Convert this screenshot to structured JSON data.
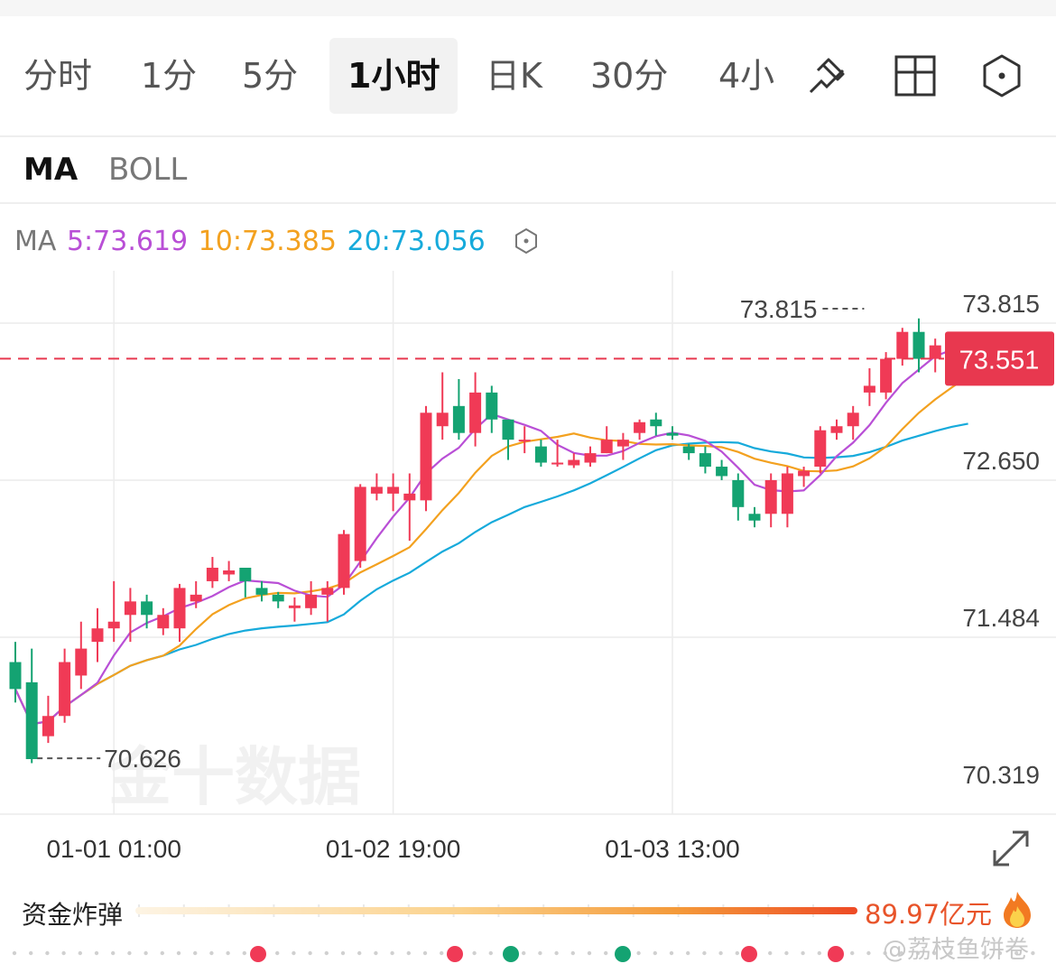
{
  "tabs": [
    {
      "label": "分时",
      "active": false
    },
    {
      "label": "1分",
      "active": false
    },
    {
      "label": "5分",
      "active": false
    },
    {
      "label": "1小时",
      "active": true
    },
    {
      "label": "日K",
      "active": false
    },
    {
      "label": "30分",
      "active": false
    },
    {
      "label": "4小",
      "active": false
    }
  ],
  "tab_icons": [
    "draw-tool-icon",
    "grid-layout-icon",
    "settings-hex-icon"
  ],
  "indicators": [
    {
      "label": "MA",
      "active": true
    },
    {
      "label": "BOLL",
      "active": false
    }
  ],
  "ma_legend": {
    "prefix": "MA",
    "ma5": "5:73.619",
    "ma10": "10:73.385",
    "ma20": "20:73.056"
  },
  "colors": {
    "up": "#f03a56",
    "down": "#14a372",
    "ma5": "#b94fd6",
    "ma10": "#f3a11f",
    "ma20": "#16aadb",
    "price_line": "#e8384f"
  },
  "chart_data": {
    "type": "candlestick",
    "y_ticks": [
      "73.815",
      "72.650",
      "71.484",
      "70.319"
    ],
    "ylim": [
      70.319,
      73.815
    ],
    "x_labels": [
      "01-01 01:00",
      "01-02 19:00",
      "01-03 13:00"
    ],
    "x_label_index": [
      6,
      23,
      40
    ],
    "current_price": "73.551",
    "max_marker": {
      "label": "73.815",
      "index": 52
    },
    "min_marker": {
      "label": "70.626",
      "index": 1
    },
    "candles": [
      [
        71.3,
        71.1,
        71.45,
        71.0
      ],
      [
        71.15,
        70.58,
        71.4,
        70.55
      ],
      [
        70.75,
        70.9,
        71.05,
        70.7
      ],
      [
        70.9,
        71.3,
        71.4,
        70.85
      ],
      [
        71.2,
        71.4,
        71.6,
        71.1
      ],
      [
        71.45,
        71.55,
        71.7,
        71.3
      ],
      [
        71.55,
        71.6,
        71.9,
        71.45
      ],
      [
        71.65,
        71.75,
        71.85,
        71.45
      ],
      [
        71.75,
        71.65,
        71.8,
        71.55
      ],
      [
        71.55,
        71.65,
        71.7,
        71.5
      ],
      [
        71.55,
        71.85,
        71.88,
        71.45
      ],
      [
        71.75,
        71.8,
        71.9,
        71.7
      ],
      [
        71.9,
        72.0,
        72.08,
        71.85
      ],
      [
        71.95,
        71.98,
        72.05,
        71.9
      ],
      [
        72.0,
        71.9,
        72.0,
        71.78
      ],
      [
        71.85,
        71.8,
        71.9,
        71.75
      ],
      [
        71.8,
        71.75,
        71.82,
        71.7
      ],
      [
        71.7,
        71.72,
        71.78,
        71.6
      ],
      [
        71.7,
        71.8,
        71.9,
        71.65
      ],
      [
        71.8,
        71.85,
        71.9,
        71.6
      ],
      [
        71.85,
        72.25,
        72.28,
        71.8
      ],
      [
        72.05,
        72.6,
        72.62,
        72.0
      ],
      [
        72.55,
        72.6,
        72.7,
        72.5
      ],
      [
        72.55,
        72.6,
        72.7,
        72.42
      ],
      [
        72.5,
        72.55,
        72.7,
        72.2
      ],
      [
        72.5,
        73.15,
        73.2,
        72.42
      ],
      [
        73.05,
        73.15,
        73.45,
        72.95
      ],
      [
        73.2,
        73.0,
        73.4,
        72.95
      ],
      [
        73.0,
        73.3,
        73.45,
        72.9
      ],
      [
        73.3,
        73.1,
        73.35,
        73.0
      ],
      [
        73.1,
        72.95,
        73.1,
        72.8
      ],
      [
        72.95,
        72.95,
        73.05,
        72.85
      ],
      [
        72.9,
        72.78,
        72.95,
        72.75
      ],
      [
        72.78,
        72.78,
        72.95,
        72.75
      ],
      [
        72.76,
        72.8,
        72.85,
        72.74
      ],
      [
        72.78,
        72.85,
        72.9,
        72.75
      ],
      [
        72.85,
        72.95,
        73.05,
        72.85
      ],
      [
        72.9,
        72.95,
        73.0,
        72.8
      ],
      [
        73.0,
        73.08,
        73.1,
        72.95
      ],
      [
        73.1,
        73.05,
        73.15,
        72.98
      ],
      [
        73.0,
        72.98,
        73.05,
        72.95
      ],
      [
        72.9,
        72.85,
        72.92,
        72.8
      ],
      [
        72.85,
        72.75,
        72.9,
        72.7
      ],
      [
        72.75,
        72.68,
        72.8,
        72.65
      ],
      [
        72.65,
        72.45,
        72.7,
        72.35
      ],
      [
        72.4,
        72.35,
        72.45,
        72.3
      ],
      [
        72.4,
        72.65,
        72.7,
        72.3
      ],
      [
        72.4,
        72.7,
        72.75,
        72.3
      ],
      [
        72.68,
        72.72,
        72.75,
        72.6
      ],
      [
        72.75,
        73.02,
        73.05,
        72.7
      ],
      [
        73.0,
        73.05,
        73.1,
        72.95
      ],
      [
        73.05,
        73.15,
        73.2,
        72.95
      ],
      [
        73.3,
        73.35,
        73.48,
        73.2
      ],
      [
        73.3,
        73.55,
        73.6,
        73.25
      ],
      [
        73.55,
        73.75,
        73.78,
        73.5
      ],
      [
        73.75,
        73.55,
        73.85,
        73.45
      ],
      [
        73.55,
        73.65,
        73.7,
        73.45
      ],
      [
        73.65,
        73.58,
        73.7,
        73.5
      ],
      [
        73.58,
        73.55,
        73.6,
        73.5
      ]
    ]
  },
  "fund_bomb": {
    "label": "资金炸弹",
    "value": "89.97亿元",
    "icon": "fire-icon"
  },
  "watermark": "@荔枝鱼饼卷",
  "chart_watermark": "金十数据",
  "expand_icon": "expand-icon"
}
